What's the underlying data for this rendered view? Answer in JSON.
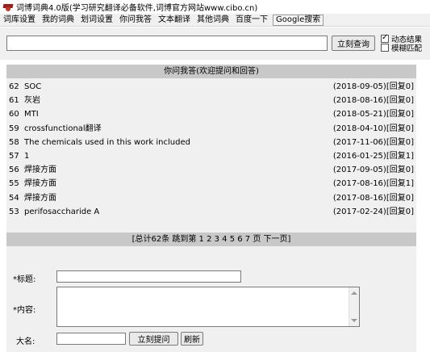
{
  "window": {
    "title": "词博词典4.0版(学习研究翻译必备软件,词博官方网站www.cibo.cn)"
  },
  "menu": {
    "items": [
      {
        "label": "词库设置"
      },
      {
        "label": "我的词典"
      },
      {
        "label": "划词设置"
      },
      {
        "label": "你问我答"
      },
      {
        "label": "文本翻译"
      },
      {
        "label": "其他词典"
      },
      {
        "label": "百度一下"
      },
      {
        "label": "Google搜索"
      }
    ]
  },
  "search": {
    "value": "",
    "button_label": "立刻查询",
    "options": [
      {
        "label": "动态结果",
        "checked": true
      },
      {
        "label": "模糊匹配",
        "checked": false
      }
    ]
  },
  "qa": {
    "header": "你问我答(欢迎提问和回答)",
    "items": [
      {
        "num": "62",
        "text": "SOC",
        "meta": "(2018-09-05)[回复0]"
      },
      {
        "num": "61",
        "text": "灰岩",
        "meta": "(2018-08-16)[回复0]"
      },
      {
        "num": "60",
        "text": "MTI",
        "meta": "(2018-05-21)[回复0]"
      },
      {
        "num": "59",
        "text": "crossfunctional翻译",
        "meta": "(2018-04-10)[回复0]"
      },
      {
        "num": "58",
        "text": "The chemicals used in this work included",
        "meta": "(2017-11-06)[回复0]"
      },
      {
        "num": "57",
        "text": "1",
        "meta": "(2016-01-25)[回复1]"
      },
      {
        "num": "56",
        "text": "焊接方面",
        "meta": "(2017-09-05)[回复0]"
      },
      {
        "num": "55",
        "text": "焊接方面",
        "meta": "(2017-08-16)[回复1]"
      },
      {
        "num": "54",
        "text": "焊接方面",
        "meta": "(2017-08-16)[回复0]"
      },
      {
        "num": "53",
        "text": "perifosaccharide A",
        "meta": "(2017-02-24)[回复0]"
      }
    ],
    "pager": "[总计62条  跳到第  1 2 3 4 5 6 7 页  下一页]"
  },
  "form": {
    "title_label": "*标题:",
    "content_label": "*内容:",
    "name_label": "大名:",
    "submit_label": "立刻提问",
    "refresh_label": "刷新"
  }
}
